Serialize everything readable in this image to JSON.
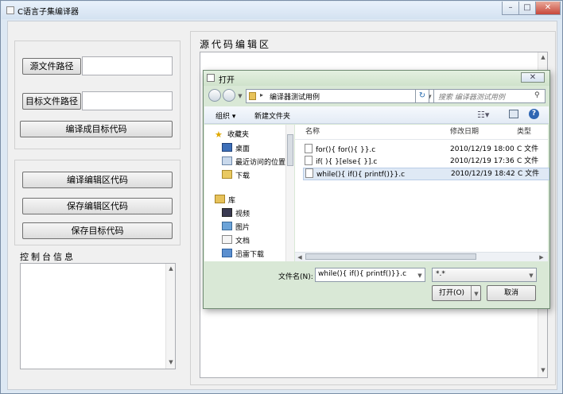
{
  "window": {
    "title": "C语言子集编译器"
  },
  "left_panel": {
    "source_path_button": "源文件路径",
    "source_path_value": "",
    "target_path_button": "目标文件路径",
    "target_path_value": "",
    "compile_to_target_button": "编译成目标代码",
    "compile_editor_button": "编译编辑区代码",
    "save_editor_button": "保存编辑区代码",
    "save_target_button": "保存目标代码",
    "console_label": "控制台信息",
    "console_text": ""
  },
  "editor": {
    "label": "源代码编辑区",
    "content": ""
  },
  "open_dialog": {
    "title": "打开",
    "address_crumb": "编译器测试用例",
    "search_placeholder": "搜索 编译器测试用例",
    "toolbar": {
      "organize": "组织 ▾",
      "new_folder": "新建文件夹"
    },
    "nav_items": [
      {
        "label": "收藏夹",
        "icon": "star-icon"
      },
      {
        "label": "桌面",
        "icon": "desktop-icon"
      },
      {
        "label": "最近访问的位置",
        "icon": "recent-places-icon"
      },
      {
        "label": "下载",
        "icon": "download-folder-icon"
      },
      {
        "label": "库",
        "icon": "library-icon"
      },
      {
        "label": "视频",
        "icon": "video-icon"
      },
      {
        "label": "图片",
        "icon": "picture-icon"
      },
      {
        "label": "文档",
        "icon": "document-icon"
      },
      {
        "label": "迅雷下载",
        "icon": "thunder-download-icon"
      }
    ],
    "columns": {
      "name": "名称",
      "modified": "修改日期",
      "type": "类型"
    },
    "files": [
      {
        "name": "for(){ for(){ }}.c",
        "modified": "2010/12/19 18:00",
        "type": "C 文件"
      },
      {
        "name": "if( ){ }[else{ }].c",
        "modified": "2010/12/19 17:36",
        "type": "C 文件"
      },
      {
        "name": "while(){ if(){ printf()}}.c",
        "modified": "2010/12/19 18:42",
        "type": "C 文件"
      }
    ],
    "selected_index": 2,
    "filename_label": "文件名(N):",
    "filename_value": "while(){ if(){ printf()}}.c",
    "filter_value": "*.*",
    "open_button": "打开(O)",
    "cancel_button": "取消"
  },
  "colors": {
    "accent": "#3b6ea5",
    "selection": "#dfe9f5",
    "dialog_frame": "#d9e8d6"
  }
}
